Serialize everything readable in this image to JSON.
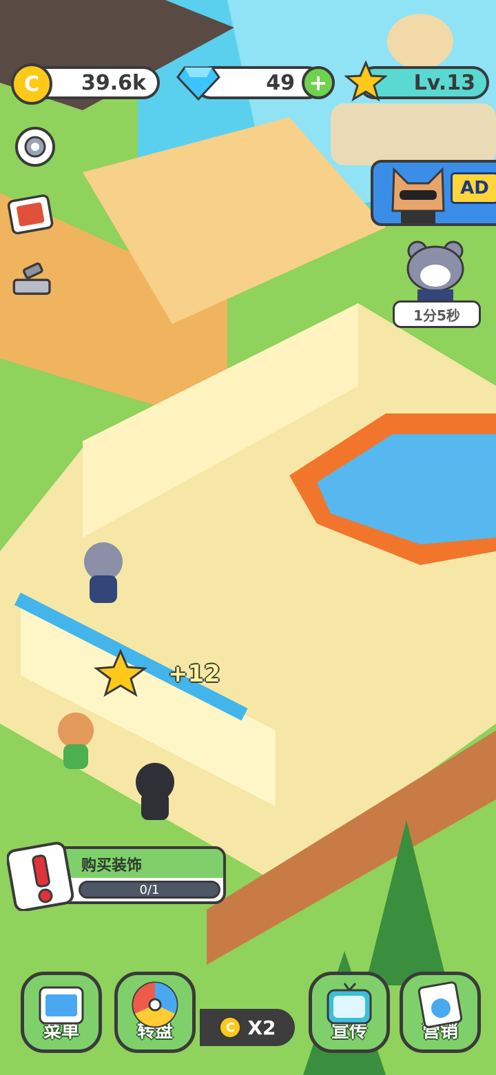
{
  "hud": {
    "coins": "39.6k",
    "gems": "49",
    "level": "Lv.13",
    "plus": "+"
  },
  "ad_badge": "AD",
  "timer": "1分5秒",
  "floating_reward": "+12",
  "task": {
    "title": "购买装饰",
    "progress_text": "0/1",
    "progress": 0
  },
  "bottom_bar": {
    "menu": "菜单",
    "wheel": "转盘",
    "multiplier": "X2",
    "promo": "宣传",
    "marketing": "营销"
  },
  "colors": {
    "accent_green": "#7fd06a",
    "coin_yellow": "#ffc91a",
    "gem_blue": "#3cc4ff",
    "outline": "#3a3a3a"
  },
  "icons": [
    "coin-icon",
    "gem-icon",
    "add-icon",
    "star-icon",
    "settings-icon",
    "album-icon",
    "build-icon",
    "ad-dog-icon",
    "visitor-cat-icon"
  ]
}
